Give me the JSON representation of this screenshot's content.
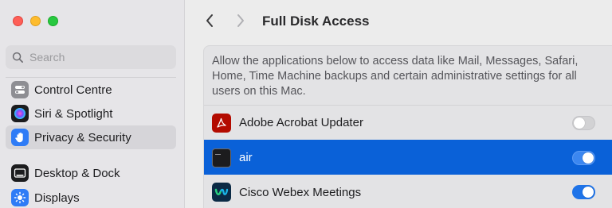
{
  "sidebar": {
    "search_placeholder": "Search",
    "items": [
      {
        "label": "Control Centre",
        "icon": "control-centre-icon"
      },
      {
        "label": "Siri & Spotlight",
        "icon": "siri-icon"
      },
      {
        "label": "Privacy & Security",
        "icon": "hand-icon",
        "selected": true
      },
      {
        "label": "Desktop & Dock",
        "icon": "dock-icon"
      },
      {
        "label": "Displays",
        "icon": "sun-icon"
      }
    ]
  },
  "header": {
    "title": "Full Disk Access"
  },
  "panel": {
    "description": "Allow the applications below to access data like Mail, Messages, Safari, Home, Time Machine backups and certain administrative settings for all users on this Mac.",
    "apps": [
      {
        "name": "Adobe Acrobat Updater",
        "enabled": false,
        "selected": false,
        "icon": "acrobat-icon"
      },
      {
        "name": "air",
        "enabled": true,
        "selected": true,
        "icon": "terminal-icon"
      },
      {
        "name": "Cisco Webex Meetings",
        "enabled": true,
        "selected": false,
        "icon": "webex-icon"
      }
    ]
  },
  "colors": {
    "selection_blue": "#0a61d8",
    "toggle_on": "#1e73e8",
    "toggle_off": "#d2d2d4"
  }
}
